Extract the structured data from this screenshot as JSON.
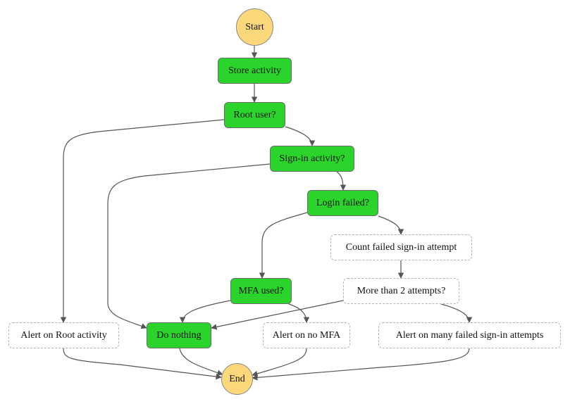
{
  "diagram": {
    "type": "state-machine-flowchart",
    "colors": {
      "task_fill": "#2ad42a",
      "terminal_fill": "#fdd87a",
      "pass_border": "#b3b3b3",
      "edge": "#555555"
    },
    "nodes": {
      "start": {
        "label": "Start",
        "kind": "terminal"
      },
      "store": {
        "label": "Store activity",
        "kind": "task"
      },
      "root": {
        "label": "Root user?",
        "kind": "task"
      },
      "signin": {
        "label": "Sign-in activity?",
        "kind": "task"
      },
      "loginfailed": {
        "label": "Login failed?",
        "kind": "task"
      },
      "count": {
        "label": "Count failed sign-in attempt",
        "kind": "pass"
      },
      "morethan": {
        "label": "More than 2 attempts?",
        "kind": "pass"
      },
      "mfa": {
        "label": "MFA used?",
        "kind": "task"
      },
      "alertroot": {
        "label": "Alert on Root activity",
        "kind": "pass"
      },
      "donothing": {
        "label": "Do nothing",
        "kind": "task"
      },
      "alertmfa": {
        "label": "Alert on no MFA",
        "kind": "pass"
      },
      "alertmany": {
        "label": "Alert on many failed sign-in attempts",
        "kind": "pass"
      },
      "end": {
        "label": "End",
        "kind": "terminal"
      }
    },
    "edges": [
      {
        "from": "start",
        "to": "store"
      },
      {
        "from": "store",
        "to": "root"
      },
      {
        "from": "root",
        "to": "signin"
      },
      {
        "from": "root",
        "to": "alertroot"
      },
      {
        "from": "signin",
        "to": "loginfailed"
      },
      {
        "from": "signin",
        "to": "donothing"
      },
      {
        "from": "loginfailed",
        "to": "count"
      },
      {
        "from": "loginfailed",
        "to": "mfa"
      },
      {
        "from": "count",
        "to": "morethan"
      },
      {
        "from": "morethan",
        "to": "donothing"
      },
      {
        "from": "morethan",
        "to": "alertmany"
      },
      {
        "from": "mfa",
        "to": "donothing"
      },
      {
        "from": "mfa",
        "to": "alertmfa"
      },
      {
        "from": "alertroot",
        "to": "end"
      },
      {
        "from": "donothing",
        "to": "end"
      },
      {
        "from": "alertmfa",
        "to": "end"
      },
      {
        "from": "alertmany",
        "to": "end"
      }
    ]
  }
}
